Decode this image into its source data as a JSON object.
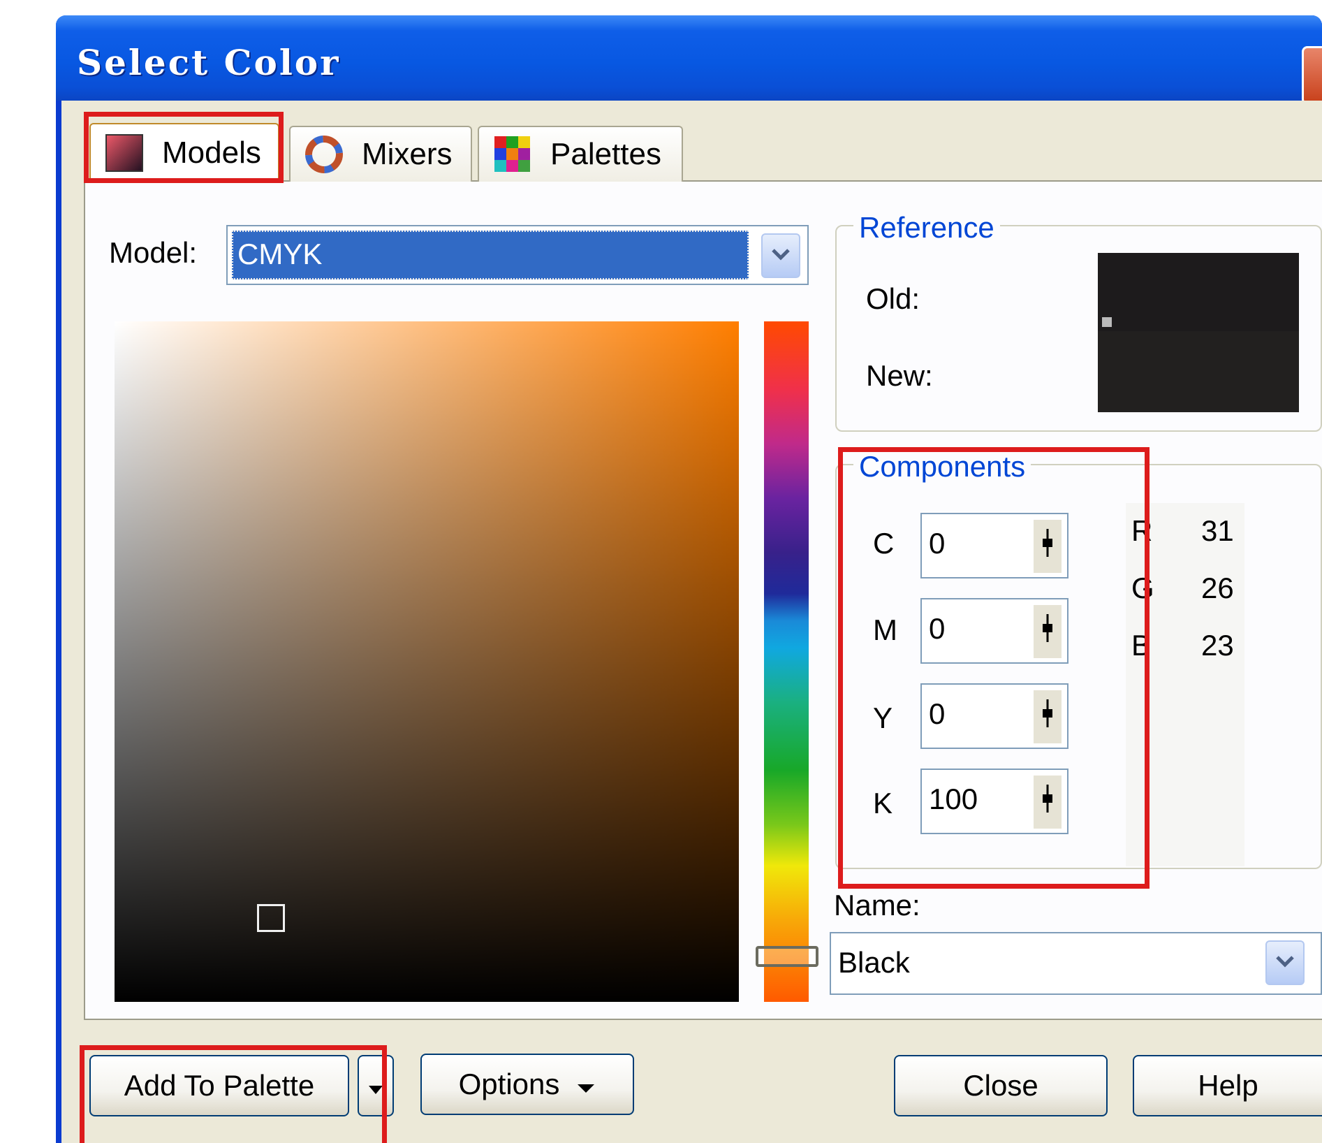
{
  "window": {
    "title": "Select Color"
  },
  "tabs": [
    {
      "label": "Models",
      "icon": "models-icon",
      "active": true
    },
    {
      "label": "Mixers",
      "icon": "mixers-icon",
      "active": false
    },
    {
      "label": "Palettes",
      "icon": "palettes-icon",
      "active": false
    }
  ],
  "model": {
    "label": "Model:",
    "value": "CMYK"
  },
  "reference": {
    "legend": "Reference",
    "old_label": "Old:",
    "new_label": "New:",
    "old_color": "#1d1b1c",
    "new_color": "#22201f"
  },
  "components": {
    "legend": "Components",
    "cmyk": [
      {
        "label": "C",
        "value": "0"
      },
      {
        "label": "M",
        "value": "0"
      },
      {
        "label": "Y",
        "value": "0"
      },
      {
        "label": "K",
        "value": "100"
      }
    ],
    "rgb": [
      {
        "label": "R",
        "value": "31"
      },
      {
        "label": "G",
        "value": "26"
      },
      {
        "label": "B",
        "value": "23"
      }
    ]
  },
  "name": {
    "label": "Name:",
    "value": "Black"
  },
  "buttons": {
    "add_to_palette": "Add To Palette",
    "options": "Options",
    "close": "Close",
    "help": "Help"
  },
  "colors": {
    "title_bar": "#0858e2",
    "highlight": "#dd1c1c",
    "legend_text": "#0046d5",
    "selection": "#316ac5"
  }
}
